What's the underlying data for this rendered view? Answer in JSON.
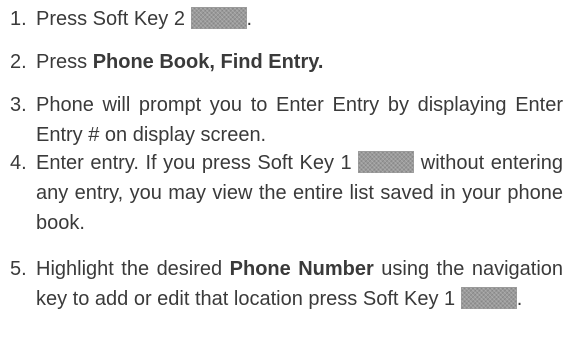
{
  "steps": [
    {
      "number": "1.",
      "text_before": "Press Soft Key 2",
      "key_icon": "soft-key-2-image",
      "text_after": "."
    },
    {
      "number": "2.",
      "text_before": "Press ",
      "bold": "Phone Book, Find Entry."
    },
    {
      "number": "3.",
      "text": "Phone will prompt you to Enter Entry by displaying Enter Entry # on display screen."
    },
    {
      "number": "4.",
      "text_before": "Enter entry. If you press Soft Key 1",
      "key_icon": "soft-key-1-image",
      "text_after": "without entering any entry, you may view the entire list saved in your phone book."
    },
    {
      "number": "5.",
      "text_before": "Highlight the desired ",
      "bold": "Phone Number",
      "text_middle": " using the navigation key to add or edit that location press Soft Key 1",
      "key_icon": "soft-key-1-image",
      "text_after": "."
    }
  ]
}
